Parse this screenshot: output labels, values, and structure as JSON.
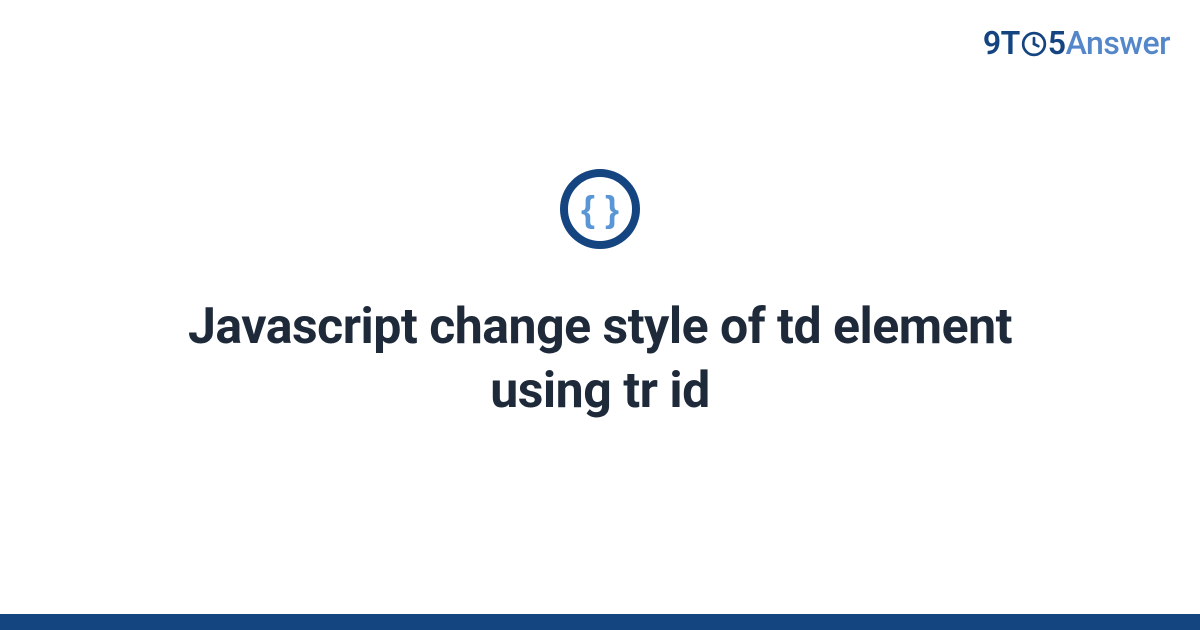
{
  "brand": {
    "part1": "9T",
    "part2": "5",
    "part3": "Answer"
  },
  "title": "Javascript change style of td element using tr id",
  "colors": {
    "primary": "#154580",
    "secondary": "#5487c9",
    "text": "#1e2a3a"
  }
}
